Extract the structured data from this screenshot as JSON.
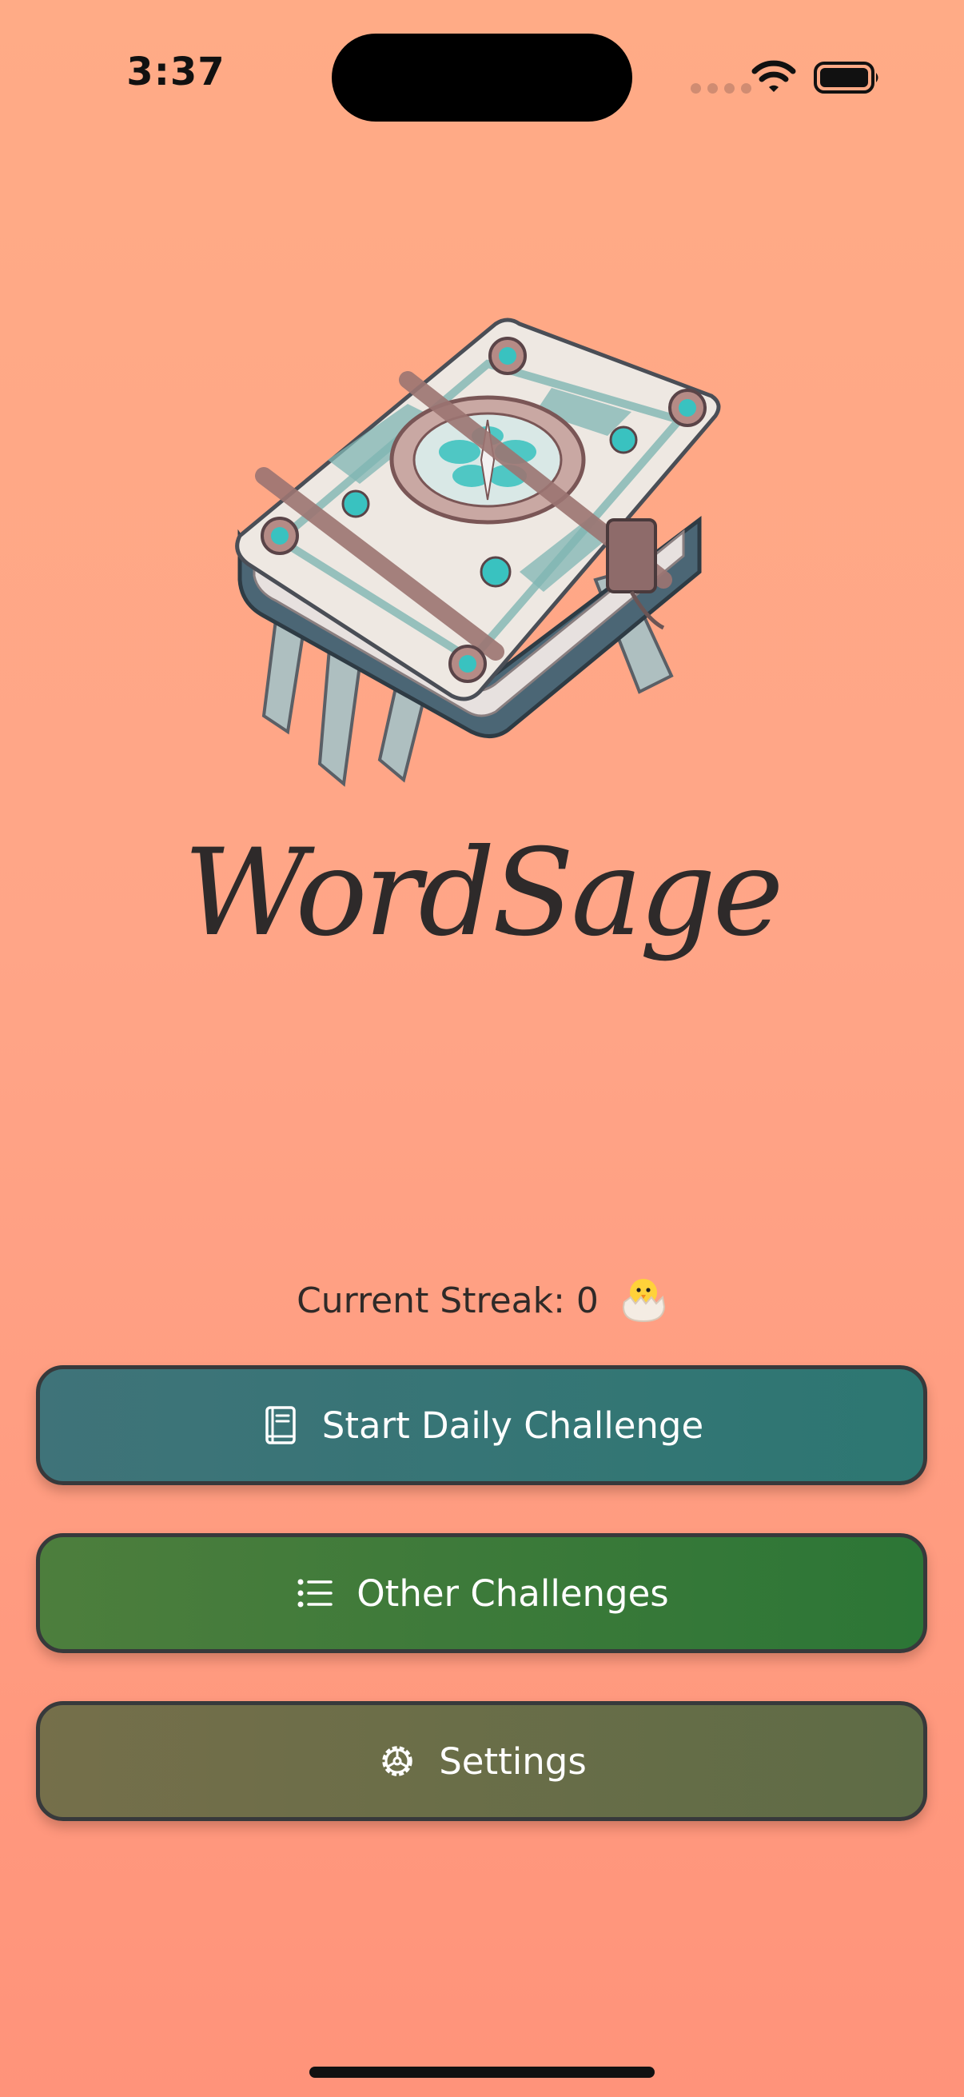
{
  "status_bar": {
    "time": "3:37",
    "icons": [
      "cellular-signal-icon",
      "wifi-icon",
      "battery-icon"
    ]
  },
  "hero": {
    "image": "ornate-spellbook-illustration",
    "app_title": "WordSage"
  },
  "streak": {
    "label": "Current Streak: 0",
    "emoji": "hatching-chick-icon"
  },
  "menu": {
    "daily": {
      "label": "Start Daily Challenge",
      "icon": "book-icon",
      "color": "#3f7379"
    },
    "other": {
      "label": "Other Challenges",
      "icon": "list-icon",
      "color": "#4d7e3d"
    },
    "settings": {
      "label": "Settings",
      "icon": "gear-icon",
      "color": "#756f4a"
    }
  },
  "colors": {
    "background_top": "#ffab86",
    "background_bottom": "#ff937a",
    "button_border": "#37393b"
  }
}
